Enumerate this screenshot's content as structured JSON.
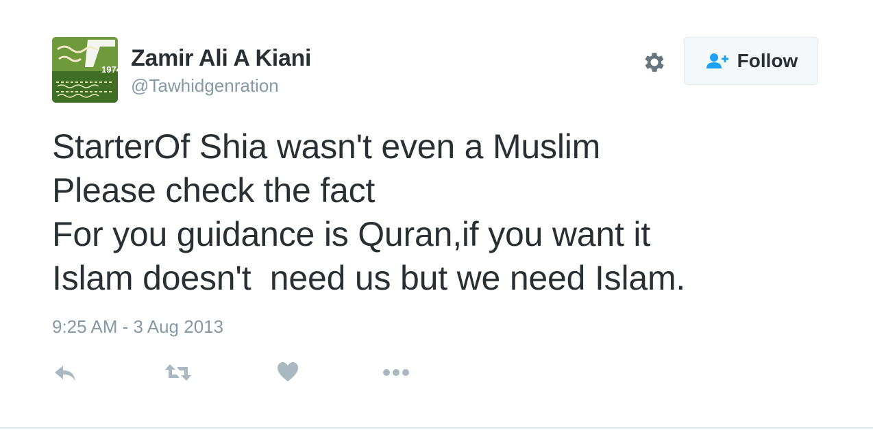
{
  "tweet": {
    "author": {
      "name": "Zamir Ali A Kiani",
      "handle": "@Tawhidgenration",
      "avatar_year": "1974"
    },
    "follow_label": "Follow",
    "text_lines": [
      "StarterOf Shia wasn't even a Muslim",
      "Please check the fact",
      "For you guidance is Quran,if you want it",
      "Islam doesn't  need us but we need Islam."
    ],
    "timestamp": "9:25 AM - 3 Aug 2013",
    "icons": {
      "settings": "gear-icon",
      "follow": "add-user-icon",
      "reply": "reply-icon",
      "retweet": "retweet-icon",
      "like": "heart-icon",
      "more": "more-icon"
    },
    "colors": {
      "text": "#292f33",
      "muted": "#8899a6",
      "accent": "#1da1f2",
      "avatar_green": "#4f7a2a"
    }
  }
}
